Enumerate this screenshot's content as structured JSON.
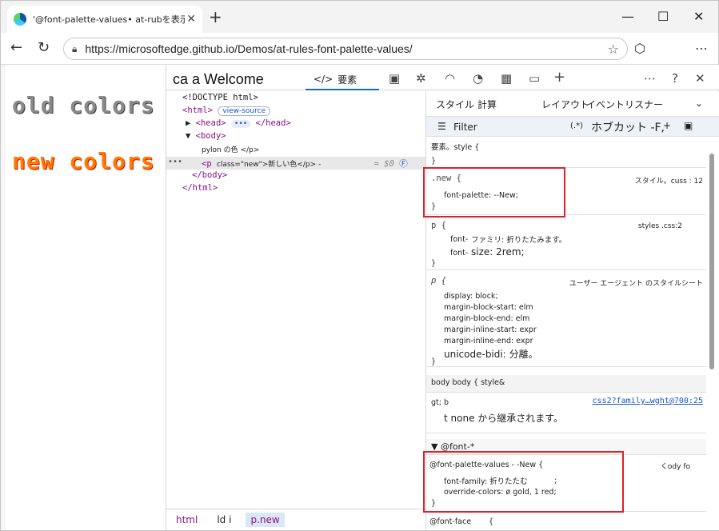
{
  "browser": {
    "tab_title": "'@font-palette-values• at-rubを表示する",
    "tab_close": "✕",
    "new_tab": "+",
    "url": "https://microsoftedge.github.io/Demos/at-rules-font-palette-values/",
    "min": "—",
    "max": "☐",
    "close": "✕"
  },
  "page": {
    "old_colors": "old colors",
    "new_colors": "new colors"
  },
  "devtools": {
    "welcome": "ca a Welcome",
    "elements_tab": "要素",
    "elements_icon": "</>"
  },
  "dom": {
    "l1": "<!DOCTYPE html>",
    "l2_tag": "<html>",
    "l2_badge": "view-source",
    "l3_pre": "<head>",
    "l3_badge": "•••",
    "l3_post": "</head>",
    "l4": "<body>",
    "l5": "pylon の色 </p>",
    "l6_tag": "<p",
    "l6_rest": "class=\"new\">新しい色</p> -",
    "l6_eq": "= $0",
    "l7": "</body>",
    "l8": "</html>",
    "dots": "•••"
  },
  "crumbs": [
    "html",
    "ld i",
    "p.new"
  ],
  "styles": {
    "tab_styles": "スタイル",
    "tab_computed": "計算",
    "tab_layout": "レイアウト",
    "tab_events": "イベントリスナー",
    "filter_label": "Filter",
    "filter_right": "(.*)",
    "filter_hover": "ホブカット -F,",
    "element_style": "要素。style {",
    "close_brace": "}",
    "new_sel": ".new {",
    "new_src": "スタイル。cuss : 12",
    "new_prop": "font-palette: --New;",
    "p_sel": "p {",
    "p_src": "styles .css:2",
    "p_prop1_a": "font-",
    "p_prop1_b": "ファミリ: 折りたたみます。",
    "p_prop2_a": "font-",
    "p_prop2_b": "size: 2rem;",
    "ua_sel": "p {",
    "ua_src": "ユーザー エージェント のスタイルシート",
    "ua_1": "display: block;",
    "ua_2": "margin-block-start: elm",
    "ua_3": "margin-block-end: elm",
    "ua_4": "margin-inline-start: expr",
    "ua_5": "margin-inline-end: expr",
    "ua_6": "unicode-bidi: 分離。",
    "body_head": "body body { style&",
    "inh_sel": "gt; b",
    "inh_link": "css2?family…wght@700:25",
    "inh_text": "t none から継承されます。",
    "font_head": "▼ @font-*",
    "fpv_sel": "@font-palette-values - -New {",
    "fpv_src": "くody fo",
    "fpv_1": "font-family: 折りたたむ",
    "fpv_1b": ";",
    "fpv_2": "override-colors: ø gold, 1 red;",
    "ff_sel": "@font-face",
    "ff_brace": "{"
  },
  "colors": {
    "highlight": "#e0202a",
    "accent": "#0f6cbd"
  }
}
